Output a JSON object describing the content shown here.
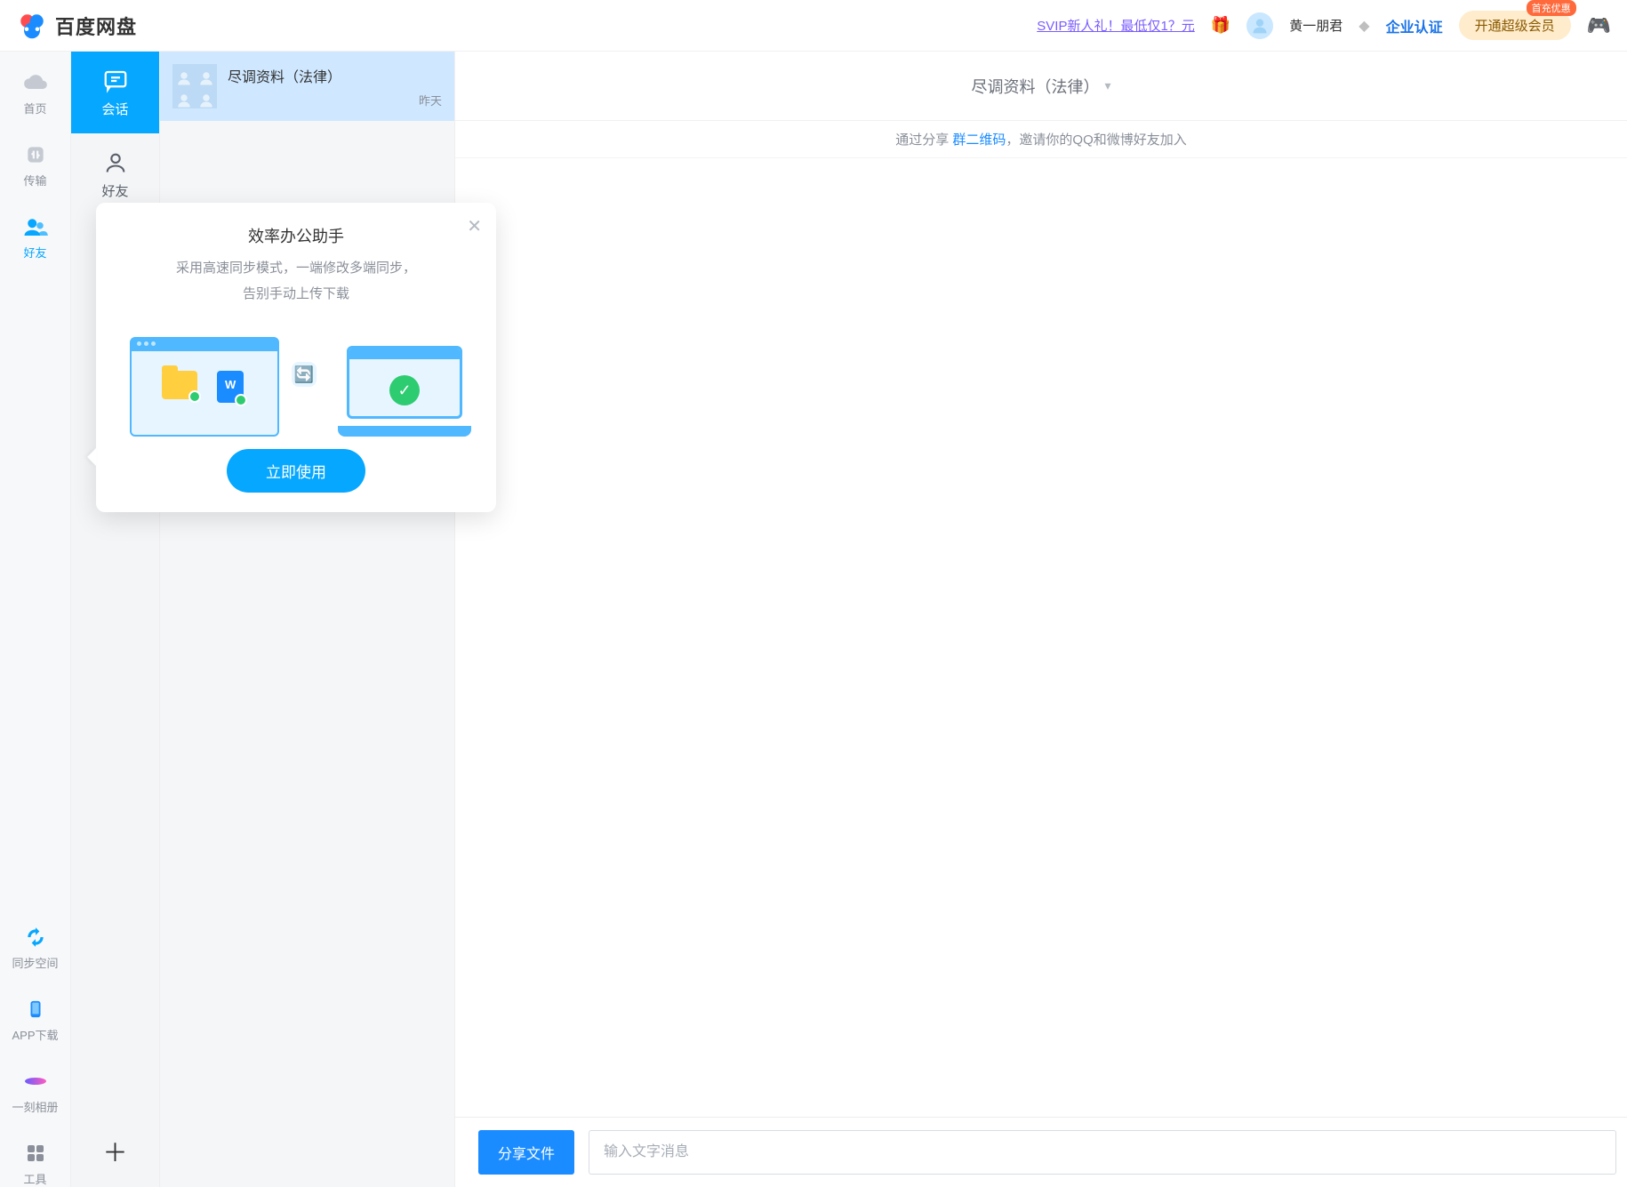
{
  "header": {
    "app_name": "百度网盘",
    "svip_promo": "SVIP新人礼！最低仅1？元",
    "username": "黄一朋君",
    "enterprise_link": "企业认证",
    "svip_button": "开通超级会员",
    "svip_badge": "首充优惠"
  },
  "sidebar_primary": [
    {
      "key": "home",
      "label": "首页"
    },
    {
      "key": "transfer",
      "label": "传输"
    },
    {
      "key": "friends",
      "label": "好友",
      "active": true
    },
    {
      "key": "sync",
      "label": "同步空间"
    },
    {
      "key": "app",
      "label": "APP下载"
    },
    {
      "key": "album",
      "label": "一刻相册"
    },
    {
      "key": "tools",
      "label": "工具"
    }
  ],
  "sidebar_secondary": [
    {
      "key": "session",
      "label": "会话",
      "active": true
    },
    {
      "key": "friends",
      "label": "好友"
    }
  ],
  "conversations": [
    {
      "title": "尽调资料（法律）",
      "time": "昨天"
    }
  ],
  "chat": {
    "header_title": "尽调资料（法律）",
    "invite_prefix": "通过分享 ",
    "invite_link": "群二维码",
    "invite_suffix": "，邀请你的QQ和微博好友加入",
    "share_button": "分享文件",
    "input_placeholder": "输入文字消息"
  },
  "promo": {
    "title": "效率办公助手",
    "line1": "采用高速同步模式，一端修改多端同步，",
    "line2": "告别手动上传下载",
    "cta": "立即使用"
  }
}
